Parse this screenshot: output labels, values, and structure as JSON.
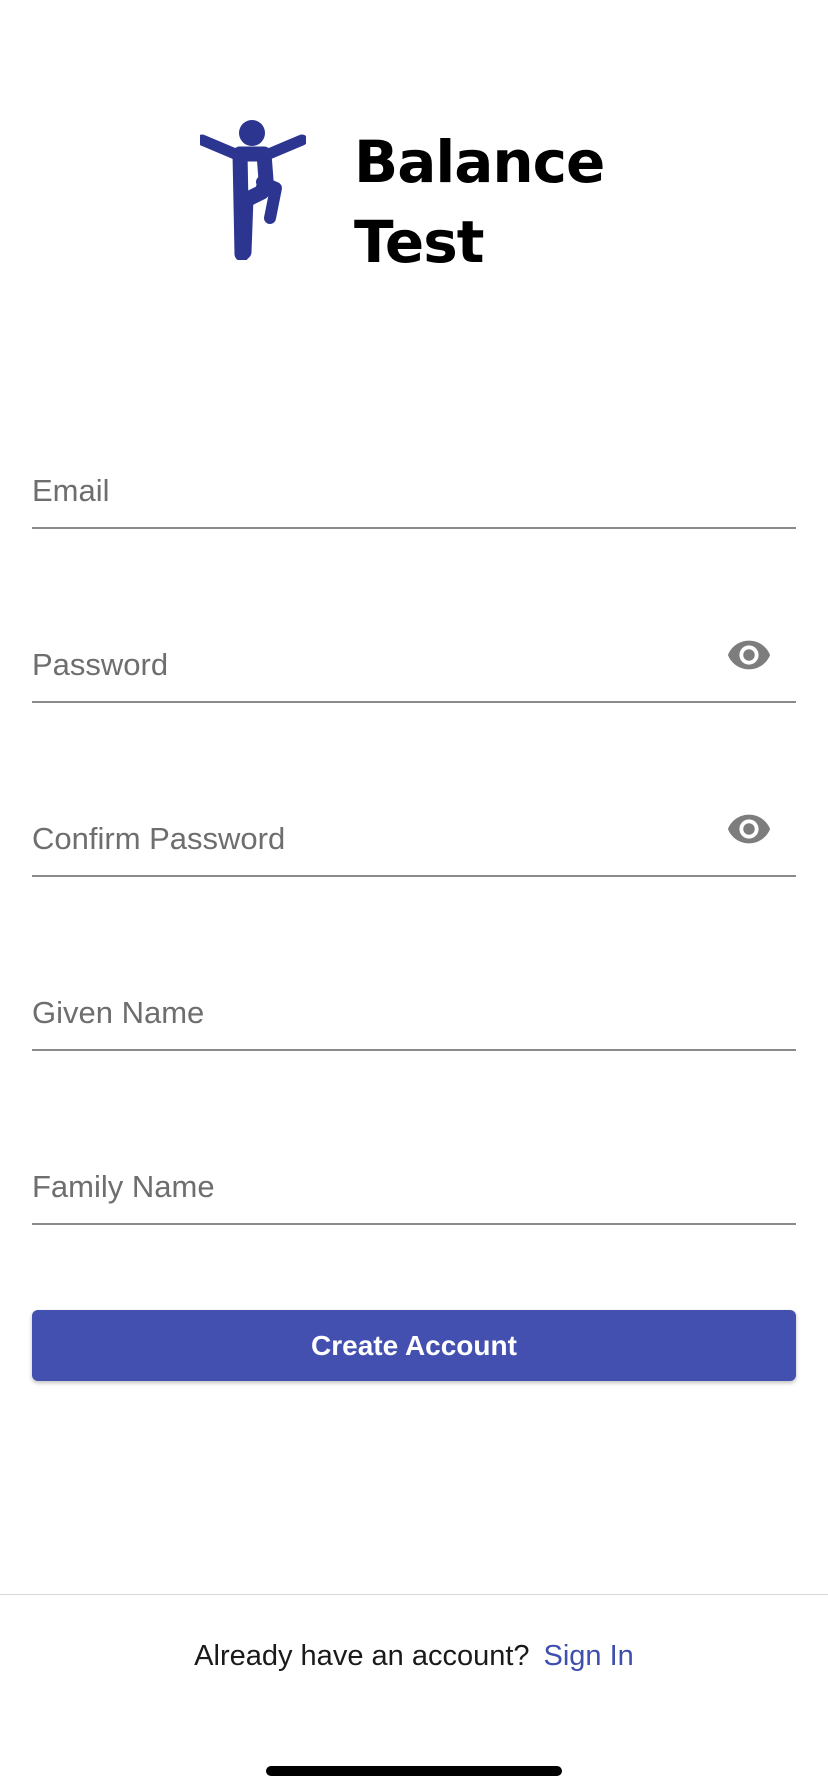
{
  "header": {
    "app_title_line1": "Balance",
    "app_title_line2": "Test",
    "logo_icon": "balance-person-icon",
    "logo_color": "#2c3590"
  },
  "form": {
    "email": {
      "placeholder": "Email",
      "value": ""
    },
    "password": {
      "placeholder": "Password",
      "value": "",
      "toggle_icon": "eye-icon"
    },
    "confirm_password": {
      "placeholder": "Confirm Password",
      "value": "",
      "toggle_icon": "eye-icon"
    },
    "given_name": {
      "placeholder": "Given Name",
      "value": ""
    },
    "family_name": {
      "placeholder": "Family Name",
      "value": ""
    }
  },
  "actions": {
    "create_account_label": "Create Account",
    "button_color": "#4350b0"
  },
  "footer": {
    "prompt": "Already have an account?",
    "sign_in_label": "Sign In",
    "link_color": "#3f4fae"
  }
}
